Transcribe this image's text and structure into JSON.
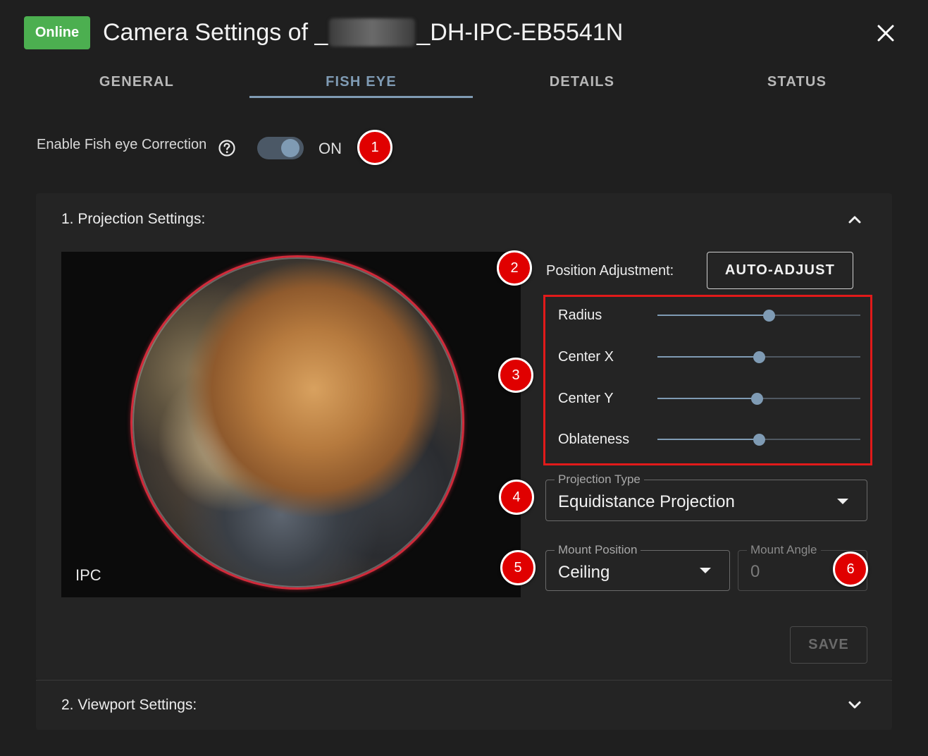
{
  "header": {
    "status": "Online",
    "title_prefix": "Camera Settings of _",
    "title_suffix": "_DH-IPC-EB5541N"
  },
  "tabs": [
    {
      "label": "GENERAL"
    },
    {
      "label": "FISH EYE"
    },
    {
      "label": "DETAILS"
    },
    {
      "label": "STATUS"
    }
  ],
  "active_tab": "FISH EYE",
  "fisheye": {
    "enable_label": "Enable Fish eye Correction",
    "enabled": true,
    "state_label": "ON"
  },
  "markers": [
    "1",
    "2",
    "3",
    "4",
    "5",
    "6"
  ],
  "projection": {
    "title": "1. Projection Settings:",
    "preview_label": "IPC",
    "position_label": "Position Adjustment:",
    "auto_adjust_label": "AUTO-ADJUST",
    "sliders": [
      {
        "label": "Radius",
        "value_fraction": 0.55
      },
      {
        "label": "Center X",
        "value_fraction": 0.5
      },
      {
        "label": "Center Y",
        "value_fraction": 0.49
      },
      {
        "label": "Oblateness",
        "value_fraction": 0.5
      }
    ],
    "projection_type": {
      "label": "Projection Type",
      "value": "Equidistance Projection"
    },
    "mount_position": {
      "label": "Mount Position",
      "value": "Ceiling"
    },
    "mount_angle": {
      "label": "Mount Angle",
      "value": "0"
    },
    "save_label": "SAVE"
  },
  "viewport": {
    "title": "2. Viewport Settings:"
  },
  "colors": {
    "accent": "#7f9bb4",
    "online": "#4caf50",
    "marker": "#e00000",
    "highlight_box": "#e11a1a",
    "background": "#1f1f1f"
  }
}
